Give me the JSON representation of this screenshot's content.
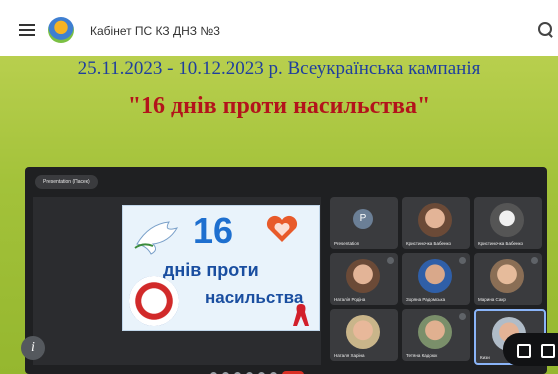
{
  "header": {
    "title": "Кабінет ПС КЗ ДНЗ №3",
    "icons": [
      "menu-icon",
      "logo",
      "search-icon"
    ]
  },
  "banner": {
    "headline": "25.11.2023 - 10.12.2023 р. Всеукраїнська кампанія",
    "subhead": "\"16 днів проти насильства\""
  },
  "meeting": {
    "presenting_label": "Presentation (Пасек)",
    "slide": {
      "number": "16",
      "line1": "днів проти",
      "line2": "насильства"
    },
    "participants": [
      {
        "name": "Presentation",
        "avatar": "P"
      },
      {
        "name": "Кристиночка Бабенко",
        "avatar": ""
      },
      {
        "name": "Кристиночка Бабенко",
        "avatar": ""
      },
      {
        "name": "Наталія Родіна",
        "avatar": ""
      },
      {
        "name": "Зоряна Радомська",
        "avatar": ""
      },
      {
        "name": "Марина Сакр",
        "avatar": ""
      },
      {
        "name": "Наталя Харіна",
        "avatar": ""
      },
      {
        "name": "Тетяна Кадоюк",
        "avatar": ""
      },
      {
        "name": "Кизи",
        "avatar": ""
      }
    ]
  }
}
